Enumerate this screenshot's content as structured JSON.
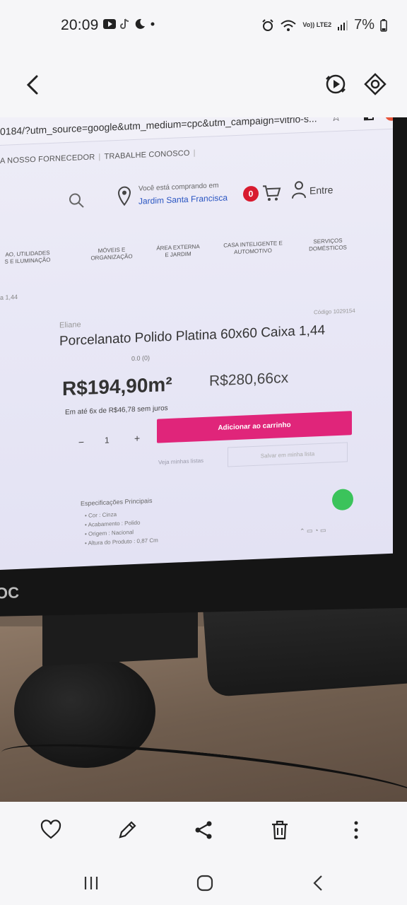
{
  "status": {
    "time": "20:09",
    "left_icons": [
      "youtube-icon",
      "tiktok-icon",
      "moon-icon",
      "dot-icon"
    ],
    "network": "Vo)) LTE2",
    "battery": "7%"
  },
  "photo_screen": {
    "url": "0184/?utm_source=google&utm_medium=cpc&utm_campaign=vitrio-s...",
    "topnav": [
      "A NOSSO FORNECEDOR",
      "TRABALHE CONOSCO"
    ],
    "location_small": "Você está comprando em",
    "location_city": "Jardim Santa Francisca",
    "cart_count": "0",
    "login_label": "Entre",
    "categories": [
      "AO, UTILIDADES\nS E ILUMINAÇÃO",
      "MÓVEIS E\nORGANIZAÇÃO",
      "ÁREA EXTERNA\nE JARDIM",
      "CASA INTELIGENTE E\nAUTOMOTIVO",
      "SERVIÇOS\nDOMÉSTICOS"
    ],
    "breadcrumb": "a 1,44",
    "product": {
      "brand": "Eliane",
      "code": "Código 1029154",
      "title": "Porcelanato Polido Platina 60x60 Caixa 1,44",
      "rating": "0.0 (0)",
      "price_m2": "R$194,90m²",
      "price_box": "R$280,66cx",
      "installments": "Em até 6x de R$46,78 sem juros",
      "qty_minus": "−",
      "quantity": "1",
      "qty_plus": "+",
      "add_to_cart": "Adicionar ao carrinho",
      "view_lists": "Veja minhas listas",
      "save_list": "Salvar em minha lista",
      "specs_title": "Especificações Principais",
      "specs": [
        "Cor : Cinza",
        "Acabamento : Polido",
        "Origem : Nacional",
        "Altura do Produto : 0,87 Cm"
      ]
    },
    "monitor_brand": "OC"
  },
  "colors": {
    "accent_pink": "#e0257a",
    "badge_red": "#d81b2f",
    "link_blue": "#2b56c2",
    "whatsapp_green": "#3bc35b"
  },
  "actions": [
    "heart-icon",
    "pencil-icon",
    "share-icon",
    "trash-icon",
    "more-icon"
  ],
  "nav": [
    "recents-icon",
    "home-icon",
    "back-icon"
  ]
}
